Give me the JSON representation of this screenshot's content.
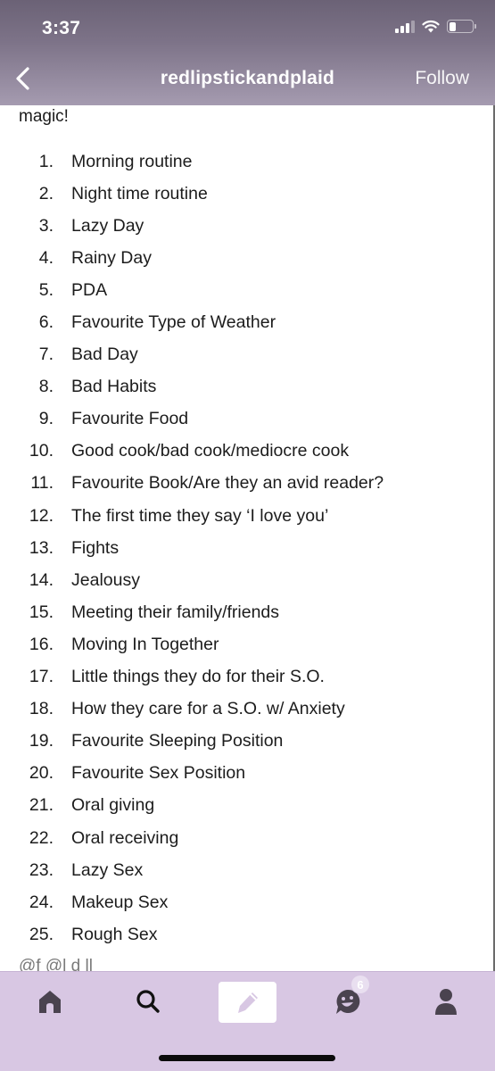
{
  "status_bar": {
    "time": "3:37",
    "signal_bars_active": 3,
    "signal_bars_total": 4,
    "battery_level": 0.3,
    "icons": [
      "cellular-signal-icon",
      "wifi-icon",
      "battery-icon"
    ]
  },
  "header": {
    "back_icon": "chevron-left-icon",
    "title": "redlipstickandplaid",
    "follow_label": "Follow"
  },
  "post": {
    "intro": "magic!",
    "items": [
      {
        "num": "1.",
        "text": "Morning routine"
      },
      {
        "num": "2.",
        "text": "Night time routine"
      },
      {
        "num": "3.",
        "text": "Lazy Day"
      },
      {
        "num": "4.",
        "text": "Rainy Day"
      },
      {
        "num": "5.",
        "text": "PDA"
      },
      {
        "num": "6.",
        "text": "Favourite Type of Weather"
      },
      {
        "num": "7.",
        "text": "Bad Day"
      },
      {
        "num": "8.",
        "text": "Bad Habits"
      },
      {
        "num": "9.",
        "text": "Favourite Food"
      },
      {
        "num": "10.",
        "text": "Good cook/bad cook/mediocre cook"
      },
      {
        "num": "11.",
        "text": "Favourite Book/Are they an avid reader?"
      },
      {
        "num": "12.",
        "text": "The first time they say ‘I love you’"
      },
      {
        "num": "13.",
        "text": "Fights"
      },
      {
        "num": "14.",
        "text": "Jealousy"
      },
      {
        "num": "15.",
        "text": "Meeting their family/friends"
      },
      {
        "num": "16.",
        "text": "Moving In Together"
      },
      {
        "num": "17.",
        "text": "Little things they do for their S.O."
      },
      {
        "num": "18.",
        "text": "How they care for a S.O. w/ Anxiety"
      },
      {
        "num": "19.",
        "text": "Favourite Sleeping Position"
      },
      {
        "num": "20.",
        "text": "Favourite Sex Position"
      },
      {
        "num": "21.",
        "text": "Oral giving"
      },
      {
        "num": "22.",
        "text": "Oral receiving"
      },
      {
        "num": "23.",
        "text": "Lazy Sex"
      },
      {
        "num": "24.",
        "text": "Makeup Sex"
      },
      {
        "num": "25.",
        "text": "Rough Sex"
      }
    ],
    "tags_partial": "@f                 @l         d   ll"
  },
  "tabbar": {
    "tabs": [
      {
        "name": "home",
        "icon": "home-icon"
      },
      {
        "name": "search",
        "icon": "search-icon"
      },
      {
        "name": "compose",
        "icon": "pencil-icon"
      },
      {
        "name": "activity",
        "icon": "activity-face-icon",
        "badge": "6"
      },
      {
        "name": "account",
        "icon": "person-icon"
      }
    ]
  },
  "colors": {
    "header_top": "#6b6276",
    "header_bottom": "#a59bb0",
    "tabbar_bg": "#d8c7e3",
    "icon_dark": "#4a434f",
    "compose_pencil": "#d8c7e3"
  }
}
